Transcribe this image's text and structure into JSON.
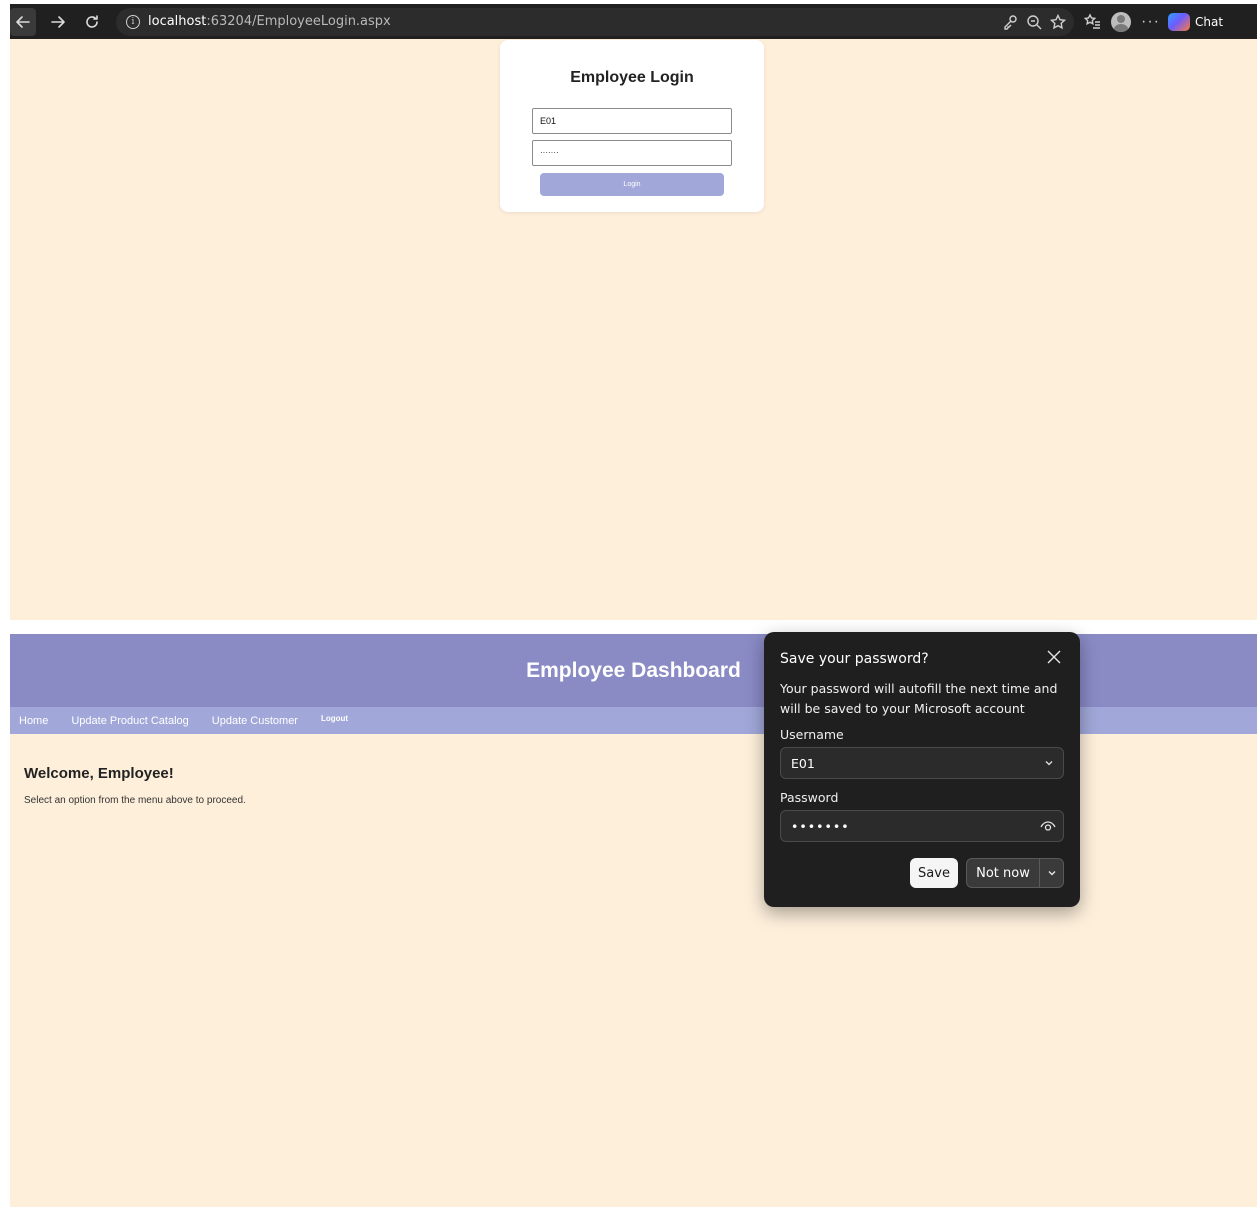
{
  "browser": {
    "url_host": "localhost",
    "url_path": ":63204/EmployeeLogin.aspx",
    "chat_label": "Chat",
    "more_label": "···"
  },
  "login": {
    "title": "Employee Login",
    "username_value": "E01",
    "password_mask": "·······",
    "button_label": "Login"
  },
  "dashboard": {
    "title": "Employee Dashboard",
    "menu": [
      "Home",
      "Update Product Catalog",
      "Update Customer",
      "Logout"
    ],
    "welcome": "Welcome, Employee!",
    "subtitle": "Select an option from the menu above to proceed."
  },
  "password_popup": {
    "title": "Save your password?",
    "description": "Your password will autofill the next time and will be saved to your Microsoft account",
    "username_label": "Username",
    "username_value": "E01",
    "password_label": "Password",
    "password_mask": "•••••••",
    "save_label": "Save",
    "not_now_label": "Not now"
  },
  "colors": {
    "page_bg": "#feefdb",
    "header_bg": "#8a8ac5",
    "menu_bg": "#a1a8d9",
    "popup_bg": "#1f1f1f"
  }
}
